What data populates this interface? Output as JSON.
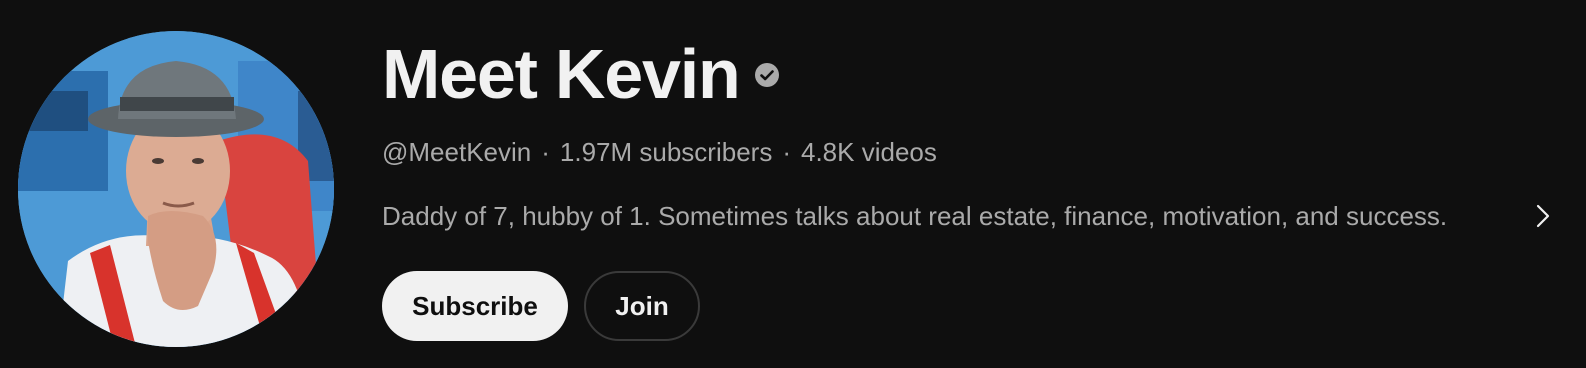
{
  "channel": {
    "name": "Meet Kevin",
    "verified_icon": "verified-check-icon",
    "handle": "@MeetKevin",
    "separator": "·",
    "subscribers": "1.97M subscribers",
    "videos": "4.8K videos",
    "description": "Daddy of 7, hubby of 1. Sometimes talks about real estate, finance, motivation, and success.",
    "more_icon": "chevron-right-icon",
    "avatar_icon": "channel-avatar"
  },
  "actions": {
    "subscribe_label": "Subscribe",
    "join_label": "Join"
  },
  "colors": {
    "background": "#0f0f0f",
    "primary_text": "#f1f1f1",
    "secondary_text": "#aaaaaa",
    "subscribe_bg": "#f1f1f1",
    "join_border": "#3a3a3a"
  }
}
